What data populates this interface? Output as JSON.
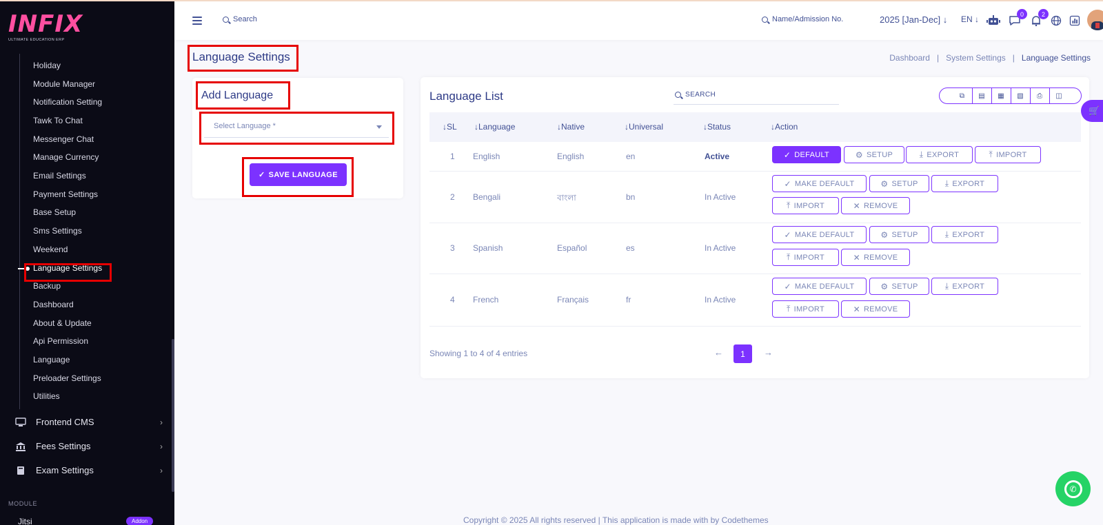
{
  "brand": {
    "logo_text": "INFIX",
    "tagline": "ULTIMATE EDUCATION ERP"
  },
  "header": {
    "search_label": "Search",
    "admission_search": "Name/Admission No.",
    "session": "2025 [Jan-Dec]",
    "language": "EN",
    "chat_count": "0",
    "notification_count": "2"
  },
  "sidebar": {
    "submenu": [
      "Holiday",
      "Module Manager",
      "Notification Setting",
      "Tawk To Chat",
      "Messenger Chat",
      "Manage Currency",
      "Email Settings",
      "Payment Settings",
      "Base Setup",
      "Sms Settings",
      "Weekend",
      "Language Settings",
      "Backup",
      "Dashboard",
      "About & Update",
      "Api Permission",
      "Language",
      "Preloader Settings",
      "Utilities"
    ],
    "active_item": "Language Settings",
    "groups": [
      "Frontend CMS",
      "Fees Settings",
      "Exam Settings"
    ],
    "module_label": "MODULE",
    "module_item": "Jitsi",
    "module_badge": "Addon"
  },
  "page": {
    "title": "Language Settings",
    "breadcrumb": [
      "Dashboard",
      "System Settings",
      "Language Settings"
    ]
  },
  "add_language": {
    "title": "Add Language",
    "select_placeholder": "Select Language *",
    "save_label": "SAVE LANGUAGE"
  },
  "language_list": {
    "title": "Language List",
    "search_placeholder": "SEARCH",
    "columns": [
      "SL",
      "Language",
      "Native",
      "Universal",
      "Status",
      "Action"
    ],
    "rows": [
      {
        "sl": "1",
        "language": "English",
        "native": "English",
        "universal": "en",
        "status": "Active",
        "actions": [
          "DEFAULT",
          "SETUP",
          "EXPORT",
          "IMPORT"
        ]
      },
      {
        "sl": "2",
        "language": "Bengali",
        "native": "বাংলা",
        "universal": "bn",
        "status": "In Active",
        "actions": [
          "MAKE DEFAULT",
          "SETUP",
          "EXPORT",
          "IMPORT",
          "REMOVE"
        ]
      },
      {
        "sl": "3",
        "language": "Spanish",
        "native": "Español",
        "universal": "es",
        "status": "In Active",
        "actions": [
          "MAKE DEFAULT",
          "SETUP",
          "EXPORT",
          "IMPORT",
          "REMOVE"
        ]
      },
      {
        "sl": "4",
        "language": "French",
        "native": "Français",
        "universal": "fr",
        "status": "In Active",
        "actions": [
          "MAKE DEFAULT",
          "SETUP",
          "EXPORT",
          "IMPORT",
          "REMOVE"
        ]
      }
    ],
    "showing": "Showing 1 to 4 of 4 entries",
    "current_page": "1"
  },
  "footer": {
    "text": "Copyright © 2025 All rights reserved | This application is made with by Codethemes"
  },
  "colors": {
    "accent": "#7c32ff",
    "text": "#415094",
    "muted": "#7a86b6",
    "sidebar": "#0b0b16",
    "highlight": "#e60000",
    "whatsapp": "#25d366"
  }
}
